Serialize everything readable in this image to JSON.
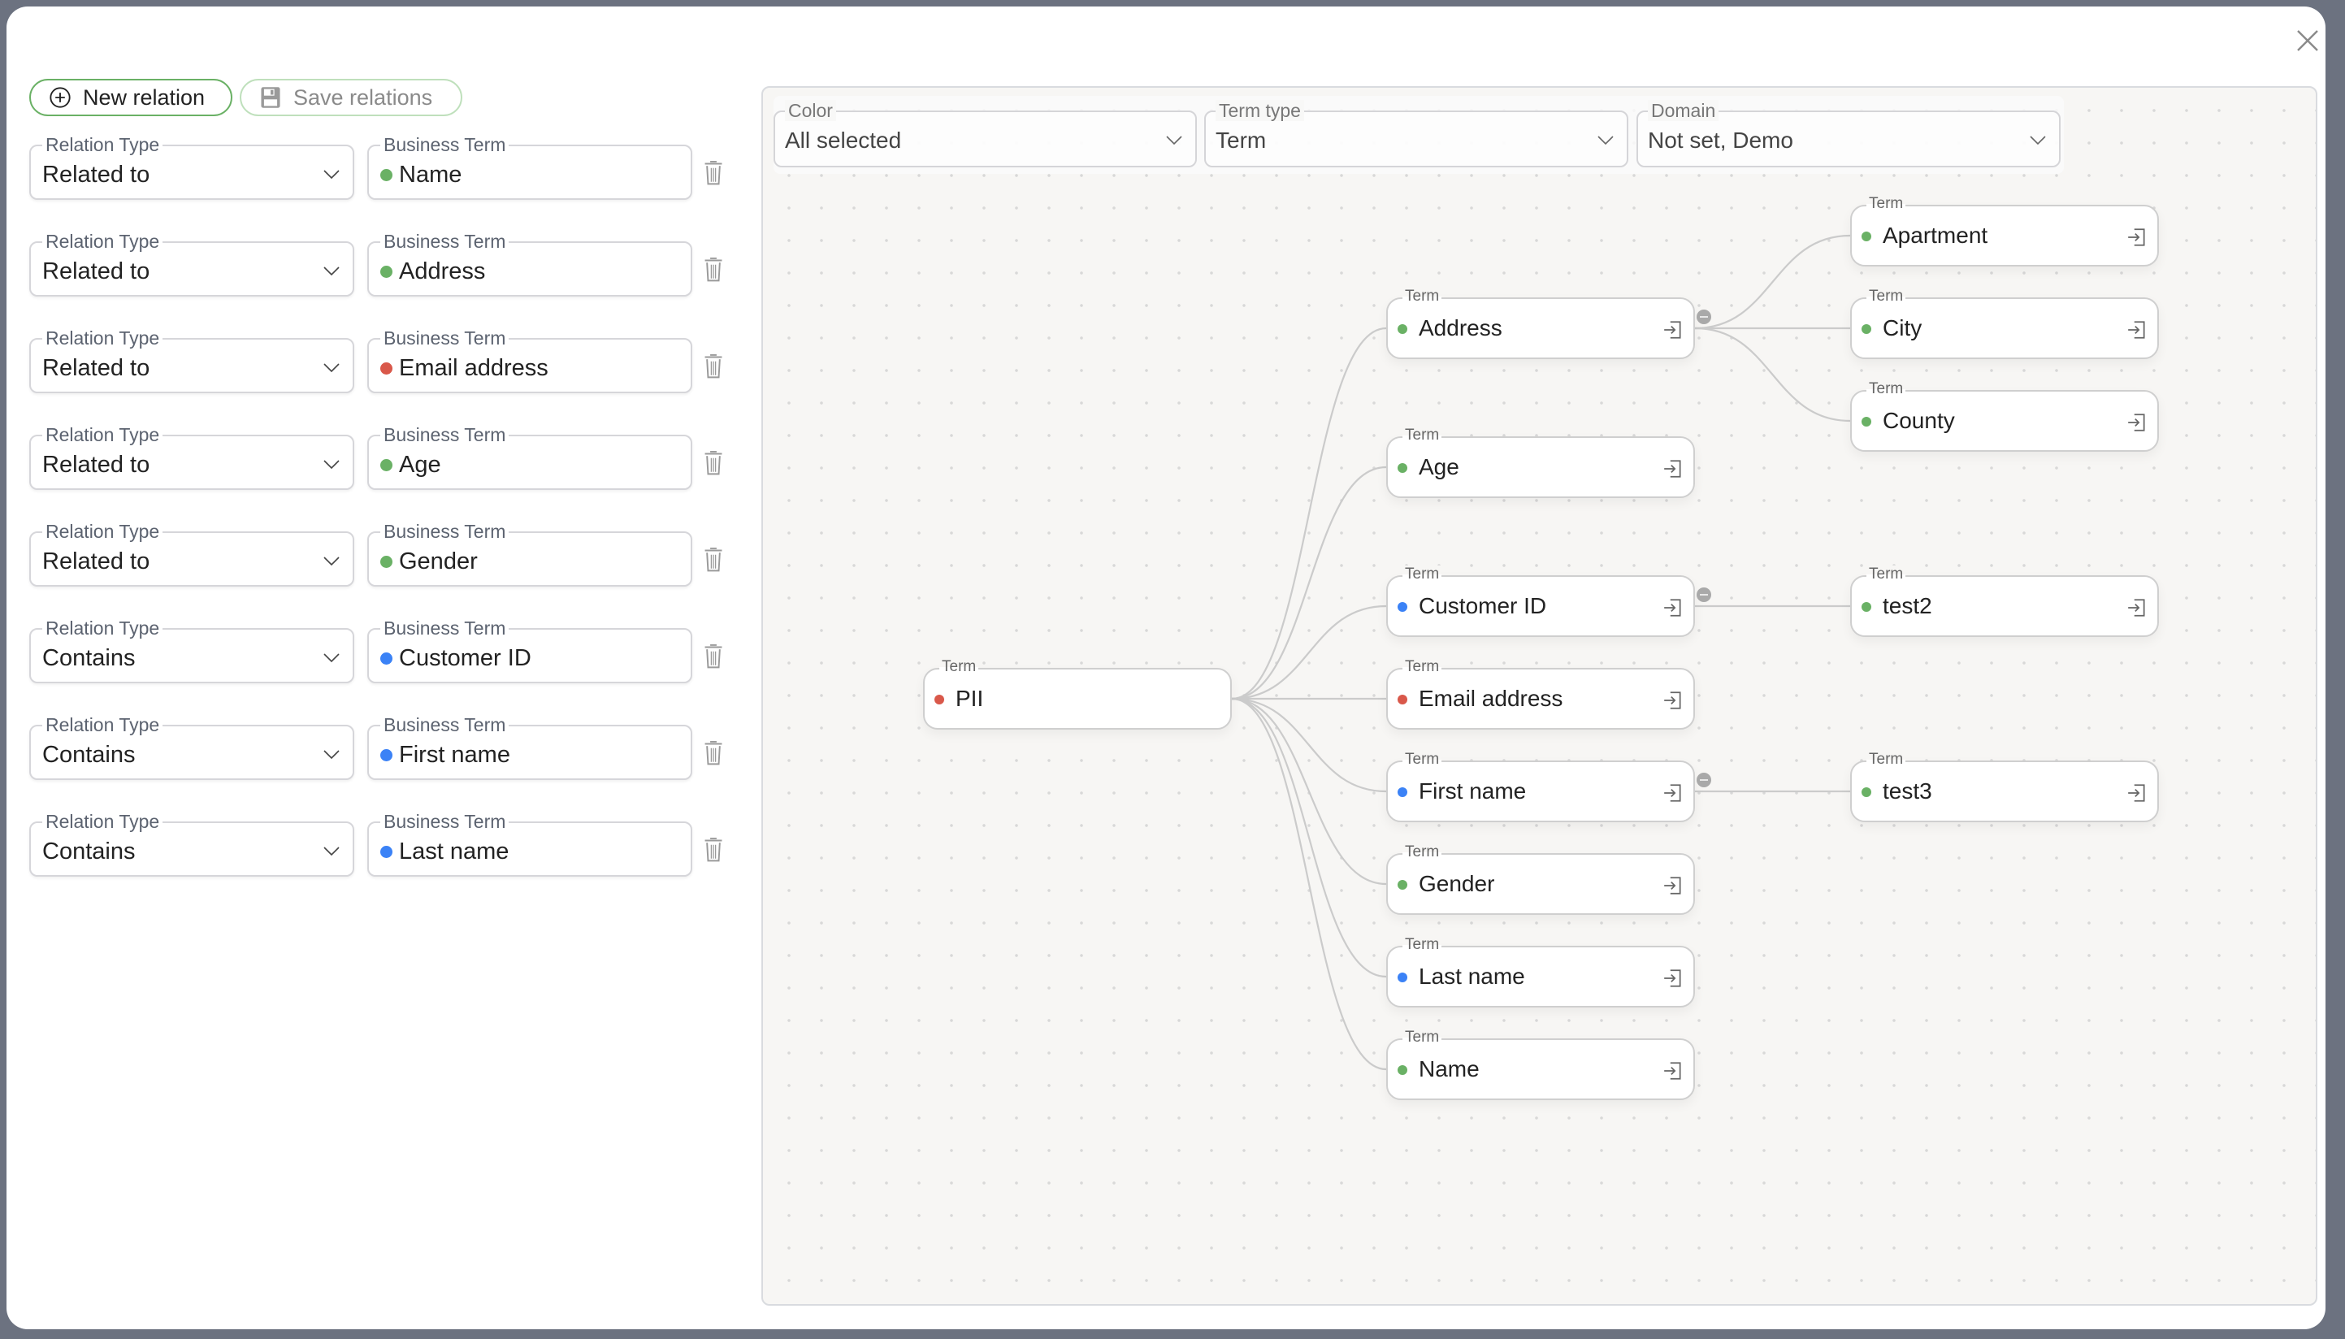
{
  "modal": {
    "close_icon": "close-icon"
  },
  "toolbar": {
    "new_relation_label": "New relation",
    "save_relations_label": "Save relations"
  },
  "relations": [
    {
      "type_label": "Relation Type",
      "type": "Related to",
      "term_label": "Business Term",
      "term": "Name",
      "color": "#6ab165"
    },
    {
      "type_label": "Relation Type",
      "type": "Related to",
      "term_label": "Business Term",
      "term": "Address",
      "color": "#6ab165"
    },
    {
      "type_label": "Relation Type",
      "type": "Related to",
      "term_label": "Business Term",
      "term": "Email address",
      "color": "#d9584a"
    },
    {
      "type_label": "Relation Type",
      "type": "Related to",
      "term_label": "Business Term",
      "term": "Age",
      "color": "#6ab165"
    },
    {
      "type_label": "Relation Type",
      "type": "Related to",
      "term_label": "Business Term",
      "term": "Gender",
      "color": "#6ab165"
    },
    {
      "type_label": "Relation Type",
      "type": "Contains",
      "term_label": "Business Term",
      "term": "Customer ID",
      "color": "#3b82f6"
    },
    {
      "type_label": "Relation Type",
      "type": "Contains",
      "term_label": "Business Term",
      "term": "First name",
      "color": "#3b82f6"
    },
    {
      "type_label": "Relation Type",
      "type": "Contains",
      "term_label": "Business Term",
      "term": "Last name",
      "color": "#3b82f6"
    }
  ],
  "filters": {
    "color": {
      "label": "Color",
      "value": "All selected"
    },
    "term_type": {
      "label": "Term type",
      "value": "Term"
    },
    "domain": {
      "label": "Domain",
      "value": "Not set, Demo"
    }
  },
  "graph": {
    "node_type_label": "Term",
    "nodes": [
      {
        "id": "pii",
        "label": "PII",
        "color": "#d9584a"
      },
      {
        "id": "address",
        "label": "Address",
        "color": "#6ab165",
        "collapsible": true
      },
      {
        "id": "age",
        "label": "Age",
        "color": "#6ab165"
      },
      {
        "id": "customer_id",
        "label": "Customer ID",
        "color": "#3b82f6",
        "collapsible": true
      },
      {
        "id": "email",
        "label": "Email address",
        "color": "#d9584a"
      },
      {
        "id": "first_name",
        "label": "First name",
        "color": "#3b82f6",
        "collapsible": true
      },
      {
        "id": "gender",
        "label": "Gender",
        "color": "#6ab165"
      },
      {
        "id": "last_name",
        "label": "Last name",
        "color": "#3b82f6"
      },
      {
        "id": "name",
        "label": "Name",
        "color": "#6ab165"
      },
      {
        "id": "apartment",
        "label": "Apartment",
        "color": "#6ab165"
      },
      {
        "id": "city",
        "label": "City",
        "color": "#6ab165"
      },
      {
        "id": "county",
        "label": "County",
        "color": "#6ab165"
      },
      {
        "id": "test2",
        "label": "test2",
        "color": "#6ab165"
      },
      {
        "id": "test3",
        "label": "test3",
        "color": "#6ab165"
      }
    ],
    "edges": [
      [
        "pii",
        "address"
      ],
      [
        "pii",
        "age"
      ],
      [
        "pii",
        "customer_id"
      ],
      [
        "pii",
        "email"
      ],
      [
        "pii",
        "first_name"
      ],
      [
        "pii",
        "gender"
      ],
      [
        "pii",
        "last_name"
      ],
      [
        "pii",
        "name"
      ],
      [
        "address",
        "apartment"
      ],
      [
        "address",
        "city"
      ],
      [
        "address",
        "county"
      ],
      [
        "customer_id",
        "test2"
      ],
      [
        "first_name",
        "test3"
      ]
    ]
  }
}
